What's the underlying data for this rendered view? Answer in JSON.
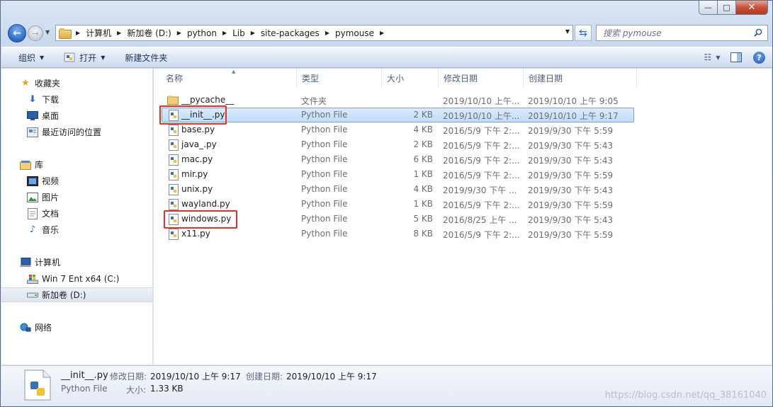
{
  "window": {
    "caption_min": "—",
    "caption_max": "□",
    "caption_close": "✕"
  },
  "address_bar": {
    "crumbs": [
      "计算机",
      "新加卷 (D:)",
      "python",
      "Lib",
      "site-packages",
      "pymouse"
    ],
    "separator": "▶",
    "dropdown": "▼"
  },
  "search": {
    "placeholder": "搜索 pymouse"
  },
  "toolbar": {
    "organize": "组织",
    "open": "打开",
    "new_folder": "新建文件夹",
    "caret": "▼"
  },
  "nav_pane": {
    "favorites": "收藏夹",
    "downloads": "下载",
    "desktop": "桌面",
    "recent": "最近访问的位置",
    "libraries": "库",
    "videos": "视频",
    "pictures": "图片",
    "documents": "文档",
    "music": "音乐",
    "computer": "计算机",
    "drive_c": "Win 7 Ent x64 (C:)",
    "drive_d": "新加卷 (D:)",
    "network": "网络"
  },
  "columns": {
    "name": "名称",
    "type": "类型",
    "size": "大小",
    "modified": "修改日期",
    "created": "创建日期"
  },
  "files": [
    {
      "name": "__pycache__",
      "type": "文件夹",
      "size": "",
      "modified": "2019/10/10 上午...",
      "created": "2019/10/10 上午 9:05",
      "kind": "folder"
    },
    {
      "name": "__init__.py",
      "type": "Python File",
      "size": "2 KB",
      "modified": "2019/10/10 上午...",
      "created": "2019/10/10 上午 9:17",
      "kind": "py"
    },
    {
      "name": "base.py",
      "type": "Python File",
      "size": "4 KB",
      "modified": "2016/5/9 下午 2:...",
      "created": "2019/9/30 下午 5:59",
      "kind": "py"
    },
    {
      "name": "java_.py",
      "type": "Python File",
      "size": "2 KB",
      "modified": "2016/5/9 下午 2:...",
      "created": "2019/9/30 下午 5:43",
      "kind": "py"
    },
    {
      "name": "mac.py",
      "type": "Python File",
      "size": "6 KB",
      "modified": "2016/5/9 下午 2:...",
      "created": "2019/9/30 下午 5:43",
      "kind": "py"
    },
    {
      "name": "mir.py",
      "type": "Python File",
      "size": "1 KB",
      "modified": "2016/5/9 下午 2:...",
      "created": "2019/9/30 下午 5:59",
      "kind": "py"
    },
    {
      "name": "unix.py",
      "type": "Python File",
      "size": "4 KB",
      "modified": "2019/9/30 下午 ...",
      "created": "2019/9/30 下午 5:43",
      "kind": "py"
    },
    {
      "name": "wayland.py",
      "type": "Python File",
      "size": "1 KB",
      "modified": "2016/5/9 下午 2:...",
      "created": "2019/9/30 下午 5:59",
      "kind": "py"
    },
    {
      "name": "windows.py",
      "type": "Python File",
      "size": "5 KB",
      "modified": "2016/8/25 上午 ...",
      "created": "2019/9/30 下午 5:43",
      "kind": "py"
    },
    {
      "name": "x11.py",
      "type": "Python File",
      "size": "8 KB",
      "modified": "2016/5/9 下午 2:...",
      "created": "2019/9/30 下午 5:59",
      "kind": "py"
    }
  ],
  "details": {
    "name": "__init__.py",
    "type": "Python File",
    "modified_label": "修改日期:",
    "modified": "2019/10/10 上午 9:17",
    "created_label": "创建日期:",
    "created": "2019/10/10 上午 9:17",
    "size_label": "大小:",
    "size": "1.33 KB"
  },
  "watermark": "https://blog.csdn.net/qq_38161040",
  "colors": {
    "highlight_box": "#e53024",
    "selection": "#c1dcfc"
  }
}
